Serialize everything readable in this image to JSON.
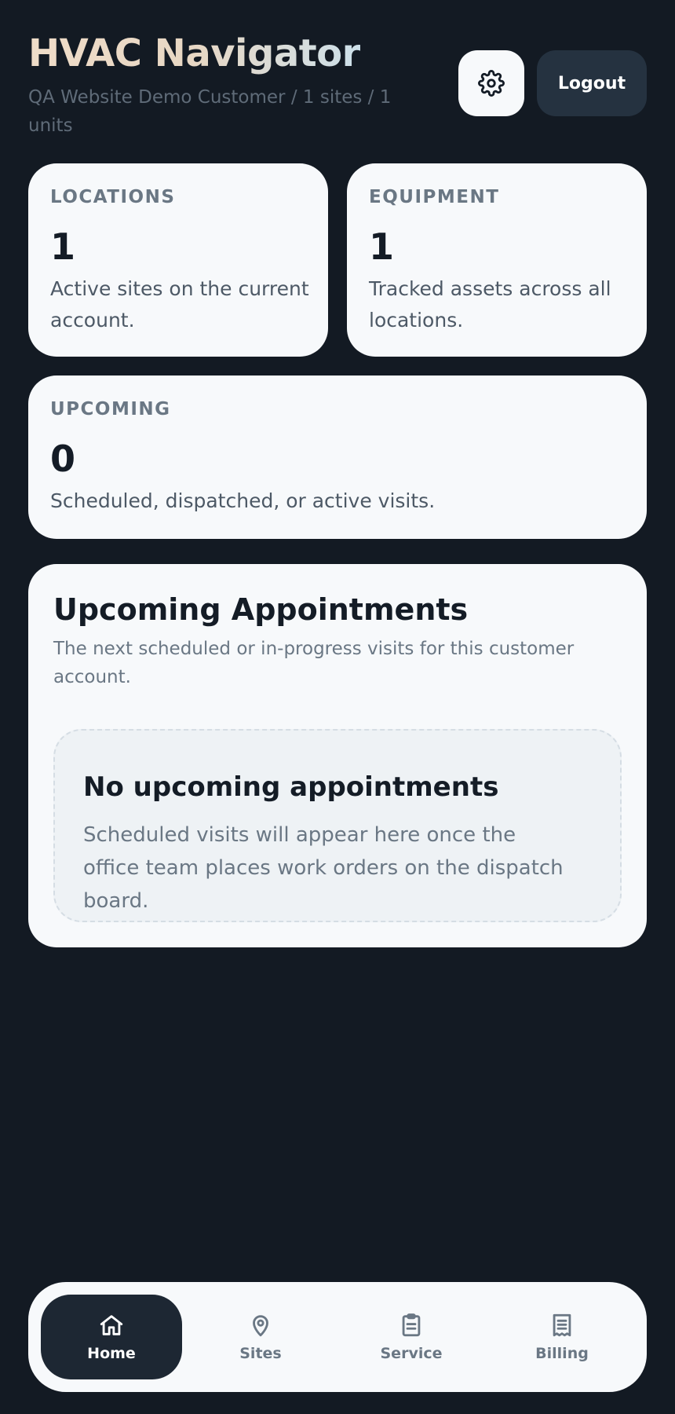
{
  "header": {
    "title": "HVAC Navigator",
    "subtitle": "QA Website Demo Customer / 1 sites / 1 units",
    "settings_icon": "gear-icon",
    "logout_label": "Logout"
  },
  "stats": {
    "locations": {
      "label": "LOCATIONS",
      "value": "1",
      "description": "Active sites on the current account."
    },
    "equipment": {
      "label": "EQUIPMENT",
      "value": "1",
      "description": "Tracked assets across all locations."
    },
    "upcoming": {
      "label": "UPCOMING",
      "value": "0",
      "description": "Scheduled, dispatched, or active visits."
    }
  },
  "appointments": {
    "title": "Upcoming Appointments",
    "subtitle": "The next scheduled or in-progress visits for this customer account.",
    "empty_title": "No upcoming appointments",
    "empty_text": "Scheduled visits will appear here once the office team places work orders on the dispatch board."
  },
  "nav": {
    "items": [
      {
        "label": "Home",
        "icon": "home-icon",
        "active": true
      },
      {
        "label": "Sites",
        "icon": "map-pin-icon",
        "active": false
      },
      {
        "label": "Service",
        "icon": "clipboard-icon",
        "active": false
      },
      {
        "label": "Billing",
        "icon": "receipt-icon",
        "active": false
      }
    ]
  },
  "colors": {
    "background": "#131a23",
    "card": "#f7f9fb",
    "nav_active": "#1d2733",
    "logout_button": "#253240"
  }
}
